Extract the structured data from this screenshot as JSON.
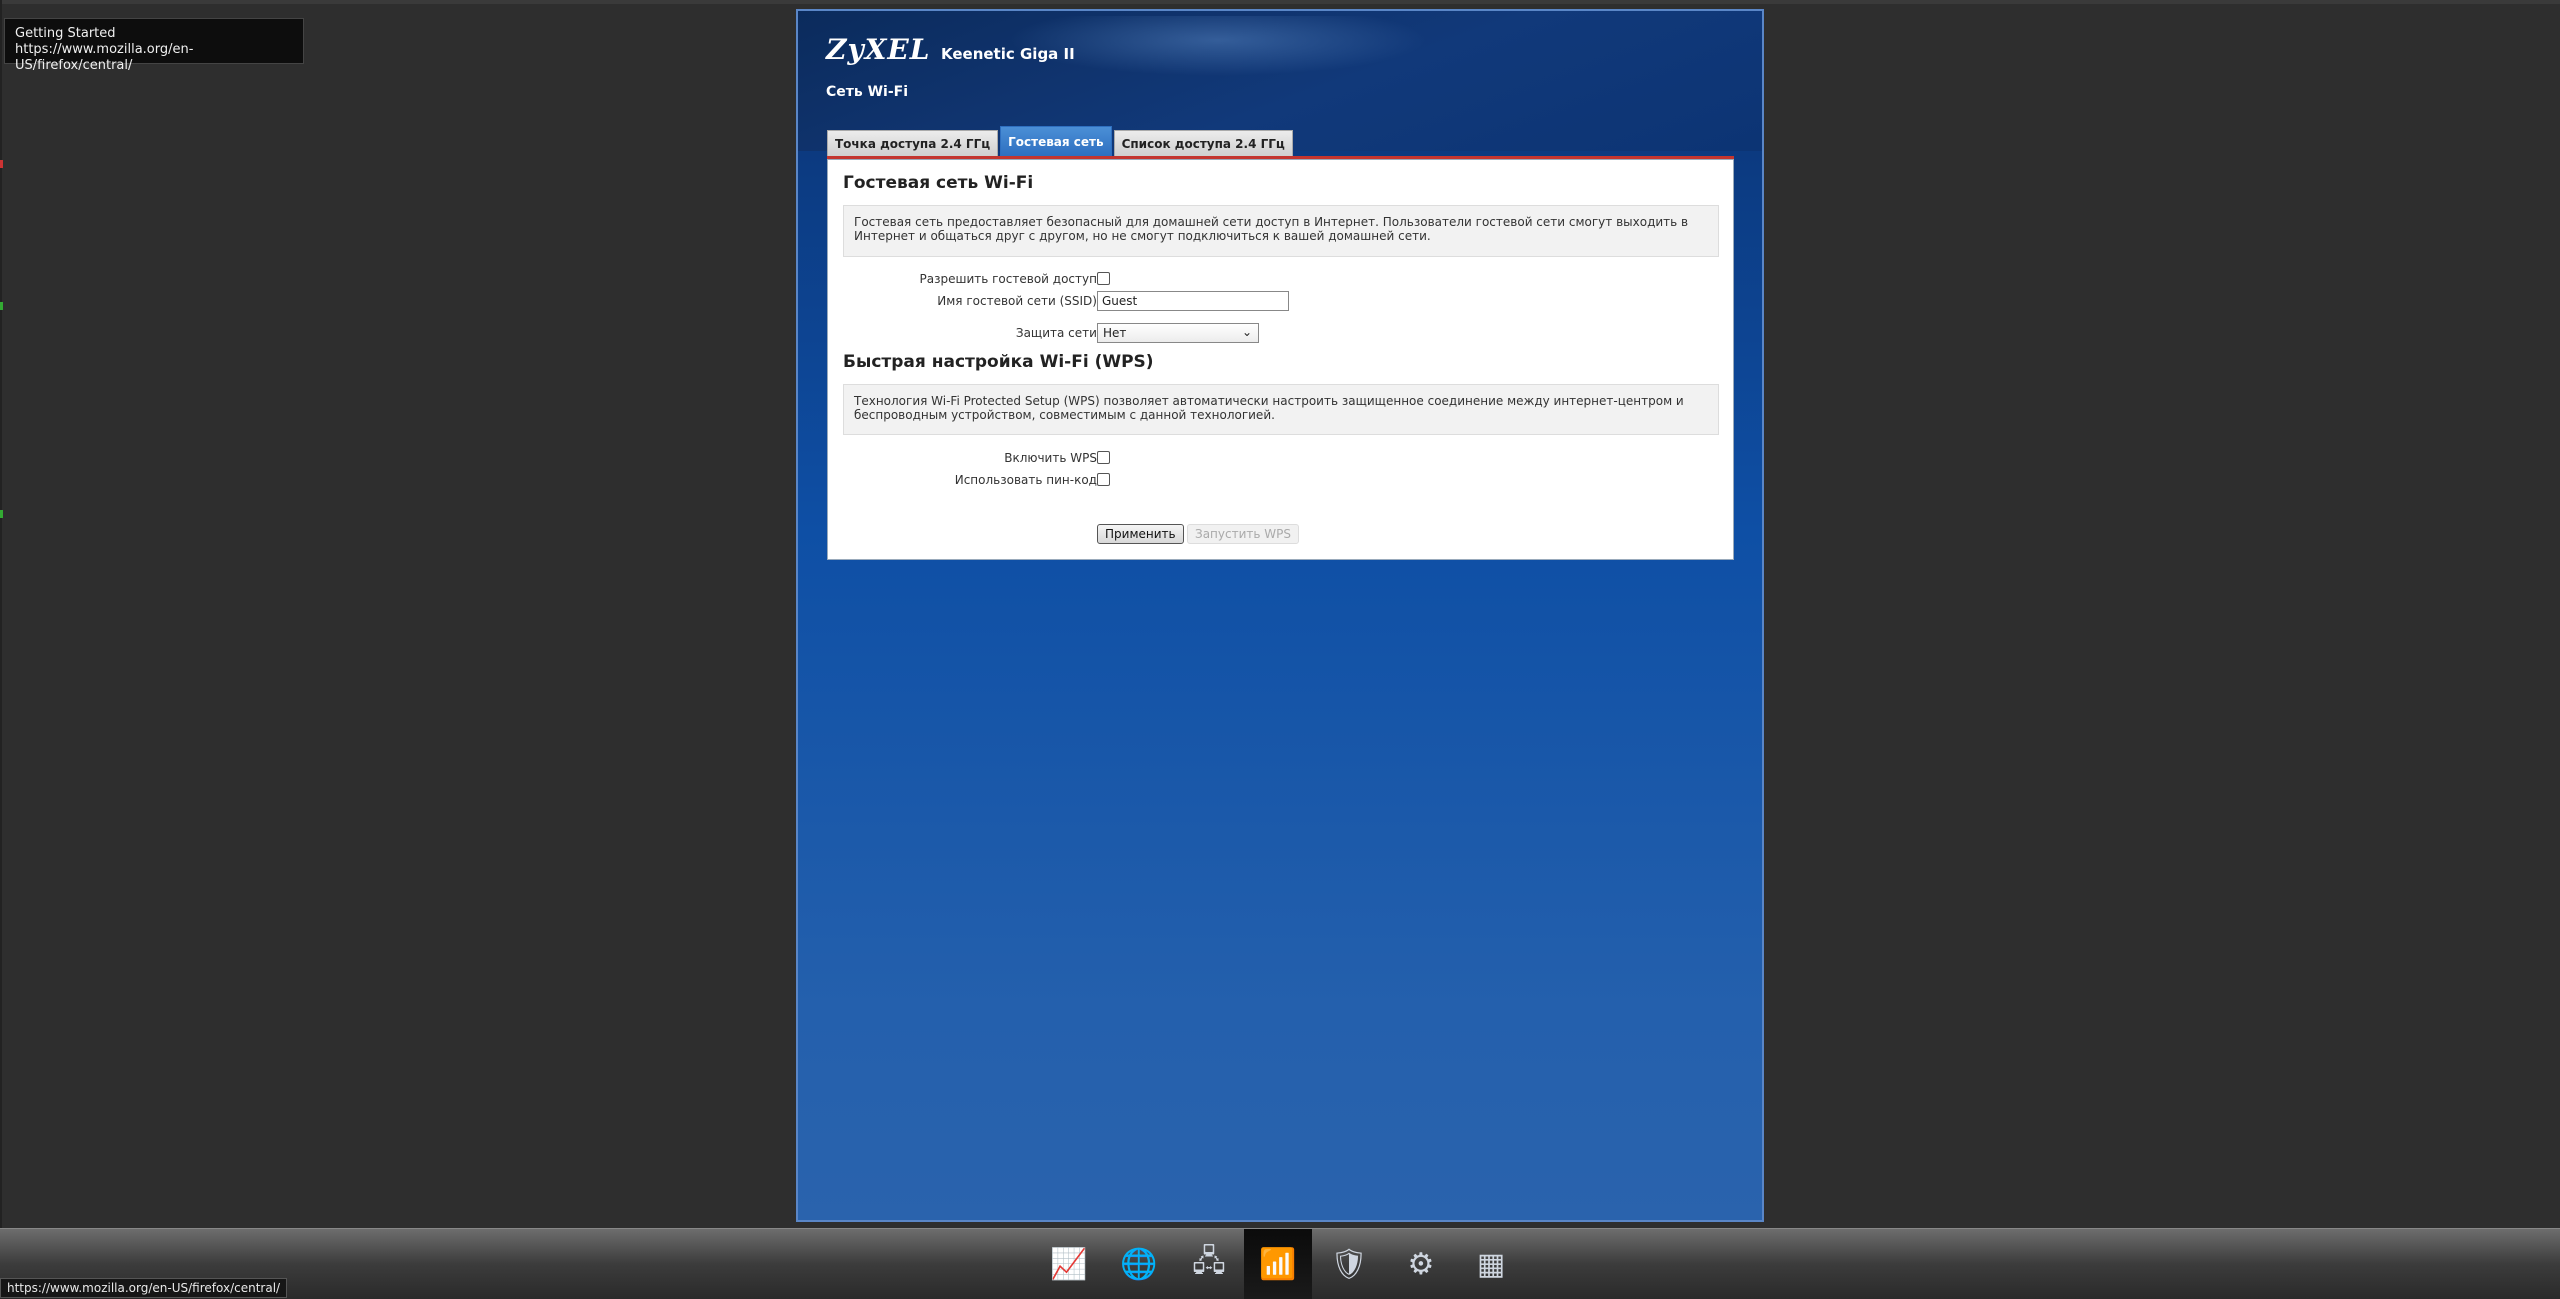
{
  "tooltip": {
    "title": "Getting Started",
    "url": "https://www.mozilla.org/en-US/firefox/central/"
  },
  "router": {
    "brand": "ZyXEL",
    "model": "Keenetic Giga II",
    "section_title": "Сеть Wi-Fi",
    "tabs": [
      {
        "label": "Точка доступа 2.4 ГГц",
        "active": false
      },
      {
        "label": "Гостевая сеть",
        "active": true
      },
      {
        "label": "Список доступа 2.4 ГГц",
        "active": false
      }
    ],
    "guest": {
      "heading": "Гостевая сеть Wi-Fi",
      "info": "Гостевая сеть предоставляет безопасный для домашней сети доступ в Интернет. Пользователи гостевой сети смогут выходить в Интернет и общаться друг с другом, но не смогут подключиться к вашей домашней сети.",
      "allow_label": "Разрешить гостевой доступ:",
      "allow_checked": false,
      "ssid_label": "Имя гостевой сети (SSID):",
      "ssid_value": "Guest",
      "security_label": "Защита сети:",
      "security_value": "Нет"
    },
    "wps": {
      "heading": "Быстрая настройка Wi-Fi (WPS)",
      "info": "Технология Wi-Fi Protected Setup (WPS) позволяет автоматически настроить защищенное соединение между интернет-центром и беспроводным устройством, совместимым с данной технологией.",
      "enable_label": "Включить WPS:",
      "enable_checked": false,
      "pin_label": "Использовать пин-код:",
      "pin_checked": false
    },
    "buttons": {
      "apply": "Применить",
      "start_wps": "Запустить WPS"
    }
  },
  "dock": {
    "icons": [
      {
        "name": "monitor-chart-icon",
        "glyph": "📈"
      },
      {
        "name": "internet-globe-icon",
        "glyph": "🌐"
      },
      {
        "name": "home-network-icon",
        "glyph": "🖧"
      },
      {
        "name": "wifi-signal-icon",
        "glyph": "📶",
        "active": true
      },
      {
        "name": "security-shield-icon",
        "glyph": "🛡"
      },
      {
        "name": "system-gear-icon",
        "glyph": "⚙"
      },
      {
        "name": "apps-grid-icon",
        "glyph": "▦"
      }
    ]
  },
  "status_bar": {
    "url": "https://www.mozilla.org/en-US/firefox/central/"
  }
}
